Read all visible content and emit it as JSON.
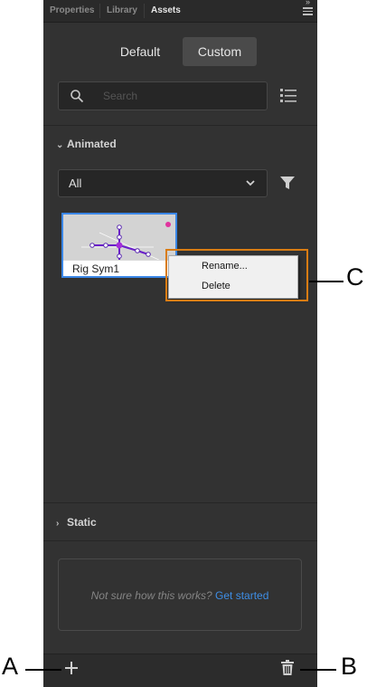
{
  "tabs": [
    "Properties",
    "Library",
    "Assets"
  ],
  "segments": {
    "default_label": "Default",
    "custom_label": "Custom"
  },
  "search": {
    "placeholder": "Search"
  },
  "animated_section": {
    "title": "Animated",
    "filter_value": "All"
  },
  "assets": [
    {
      "name": "Rig Sym1"
    }
  ],
  "context_menu": {
    "items": [
      "Rename...",
      "Delete"
    ]
  },
  "static_section": {
    "title": "Static"
  },
  "info": {
    "question": "Not sure how this works?",
    "link": "Get started"
  },
  "callouts": {
    "a": "A",
    "b": "B",
    "c": "C"
  },
  "icons": [
    "search-icon",
    "list-view-icon",
    "chevron-down-icon",
    "filter-icon",
    "chevron-right-icon",
    "add-icon",
    "trash-icon",
    "panel-menu-icon"
  ],
  "colors": {
    "panel_bg": "#323232",
    "selection_border": "#3a86e6",
    "highlight_box": "#d97c13",
    "link": "#3e8ee6"
  }
}
